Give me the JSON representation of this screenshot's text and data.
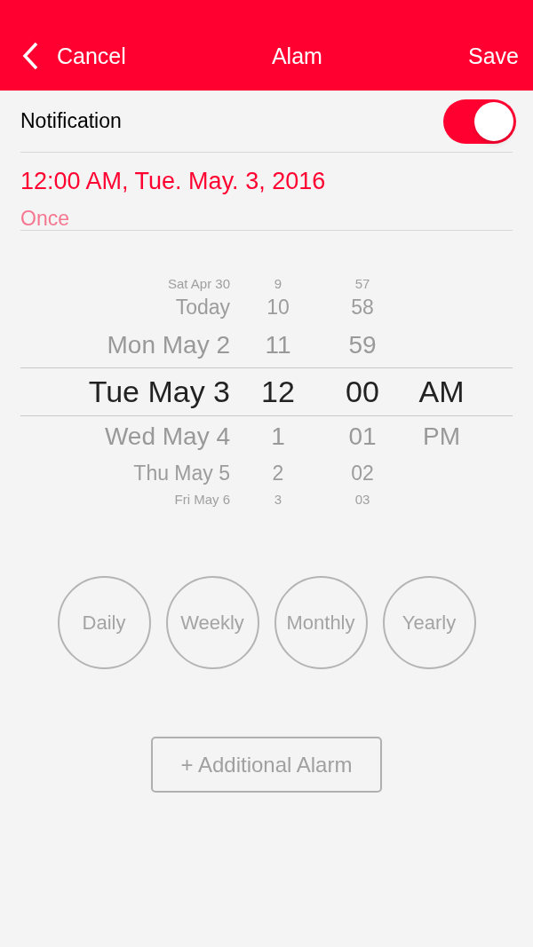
{
  "nav_bar": {
    "back": "Cancel",
    "title": "Alam",
    "action": "Save"
  },
  "notification": {
    "label": "Notification",
    "on": true
  },
  "summary": {
    "datetime": "12:00 AM, Tue. May. 3, 2016",
    "repeat": "Once"
  },
  "picker": {
    "rows": [
      {
        "date": "Sat Apr 30",
        "hour": "9",
        "minute": "57",
        "selected": false
      },
      {
        "date": "Today",
        "hour": "10",
        "minute": "58",
        "selected": false
      },
      {
        "date": "Mon May 2",
        "hour": "11",
        "minute": "59",
        "selected": false
      },
      {
        "date": "Tue May 3",
        "hour": "12",
        "minute": "00",
        "period": "AM",
        "selected": true
      },
      {
        "date": "Wed May 4",
        "hour": "1",
        "minute": "01",
        "period": "PM",
        "selected": false
      },
      {
        "date": "Thu May 5",
        "hour": "2",
        "minute": "02",
        "selected": false
      },
      {
        "date": "Fri May 6",
        "hour": "3",
        "minute": "03",
        "selected": false
      }
    ]
  },
  "repeat_options": [
    {
      "label": "Daily",
      "selected": false
    },
    {
      "label": "Weekly",
      "selected": false
    },
    {
      "label": "Monthly",
      "selected": false
    },
    {
      "label": "Yearly",
      "selected": false
    }
  ],
  "add_button": "+ Additional Alarm"
}
